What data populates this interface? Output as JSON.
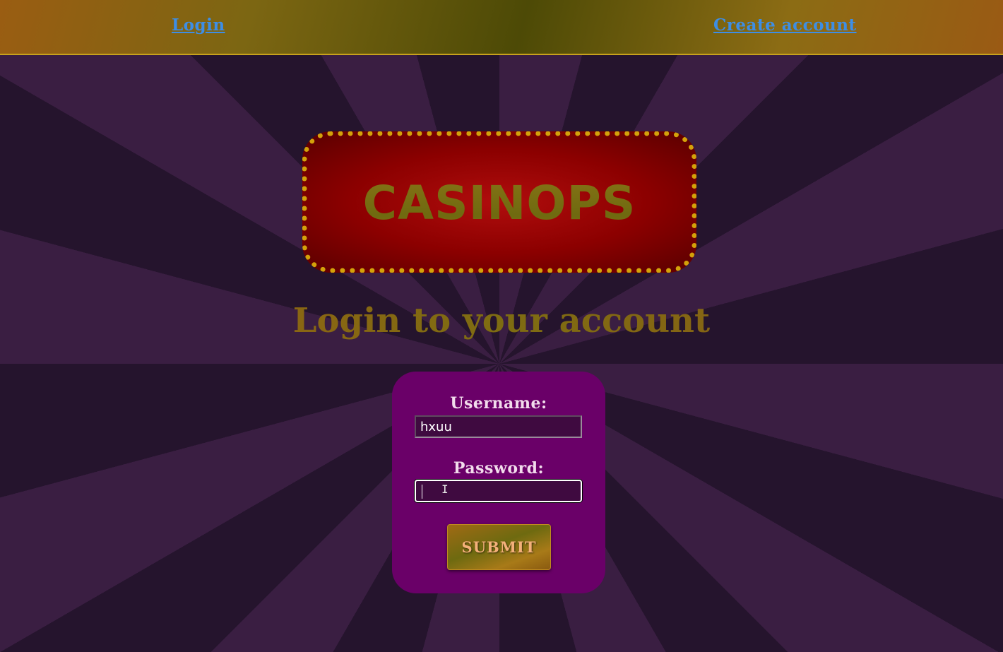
{
  "nav": {
    "login_label": "Login",
    "create_account_label": "Create account"
  },
  "brand": {
    "title": "CASINOPS"
  },
  "page": {
    "subtitle": "Login to your account"
  },
  "form": {
    "username_label": "Username:",
    "username_value": "hxuu",
    "password_label": "Password:",
    "password_value": "",
    "submit_label": "SUBMIT"
  },
  "colors": {
    "link": "#3d8ee6",
    "card": "#6a0068",
    "gold": "#d4a20a",
    "marquee_red": "#b00d0d"
  }
}
